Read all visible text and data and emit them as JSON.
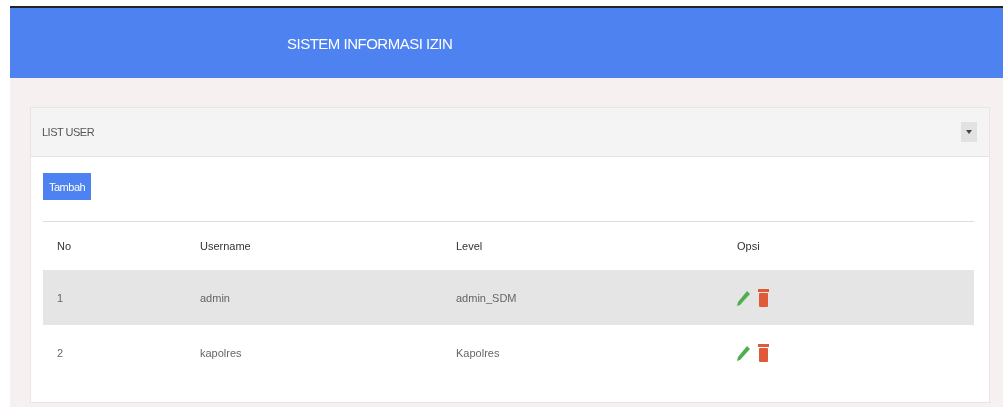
{
  "header": {
    "title": "SISTEM INFORMASI IZIN"
  },
  "panel": {
    "title": "LIST USER",
    "add_button": "Tambah"
  },
  "table": {
    "columns": [
      "No",
      "Username",
      "Level",
      "Opsi"
    ],
    "rows": [
      {
        "no": "1",
        "username": "admin",
        "level_name": "admin_SDM",
        "selected": true
      },
      {
        "no": "2",
        "username": "kapolres",
        "level_name": "Kapolres",
        "selected": false
      }
    ]
  }
}
